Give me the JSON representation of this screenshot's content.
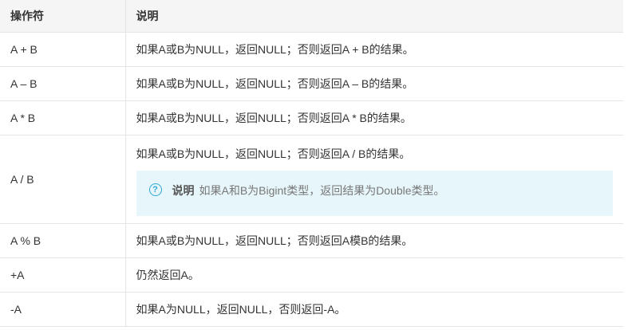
{
  "header": {
    "col1": "操作符",
    "col2": "说明"
  },
  "rows": [
    {
      "op": "A + B",
      "desc": "如果A或B为NULL，返回NULL；否则返回A + B的结果。"
    },
    {
      "op": "A – B",
      "desc": "如果A或B为NULL，返回NULL；否则返回A – B的结果。"
    },
    {
      "op": "A * B",
      "desc": "如果A或B为NULL，返回NULL；否则返回A * B的结果。"
    },
    {
      "op": "A / B",
      "desc": "如果A或B为NULL，返回NULL；否则返回A / B的结果。"
    },
    {
      "op": "A % B",
      "desc": "如果A或B为NULL，返回NULL；否则返回A模B的结果。"
    },
    {
      "op": "+A",
      "desc": "仍然返回A。"
    },
    {
      "op": "-A",
      "desc": "如果A为NULL，返回NULL，否则返回-A。"
    }
  ],
  "note": {
    "icon": "question-circle-icon",
    "icon_glyph": "?",
    "title": "说明",
    "text": "如果A和B为Bigint类型，返回结果为Double类型。"
  }
}
